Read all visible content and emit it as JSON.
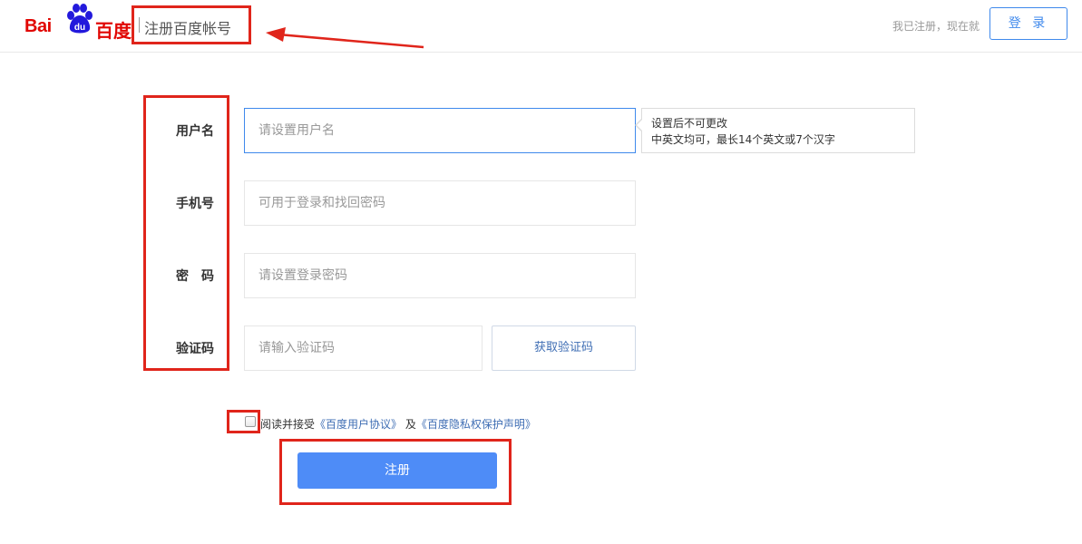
{
  "header": {
    "logo": {
      "text_latin": "Bai",
      "text_paw": "du",
      "text_cn": "百度"
    },
    "title": "注册百度帐号",
    "already_registered": "我已注册，现在就",
    "login_label": "登 录"
  },
  "form": {
    "fields": [
      {
        "label": "用户名",
        "placeholder": "请设置用户名"
      },
      {
        "label": "手机号",
        "placeholder": "可用于登录和找回密码"
      },
      {
        "label": "密　码",
        "placeholder": "请设置登录密码"
      },
      {
        "label": "验证码",
        "placeholder": "请输入验证码"
      }
    ],
    "tip": {
      "line1": "设置后不可更改",
      "line2": "中英文均可，最长14个英文或7个汉字"
    },
    "captcha_button": "获取验证码",
    "agreement": {
      "prefix": "阅读并接受",
      "link1": "《百度用户协议》",
      "middle": "及",
      "link2": "《百度隐私权保护声明》"
    },
    "submit_label": "注册"
  },
  "colors": {
    "brand_red": "#e10602",
    "brand_blue": "#2319dc",
    "accent_blue": "#3f89ec",
    "submit_blue": "#4e8cf7",
    "annotation_red": "#e0251b"
  },
  "icons": {
    "logo_paw": "baidu-paw-icon",
    "annotation_arrow": "arrow-left-icon"
  }
}
